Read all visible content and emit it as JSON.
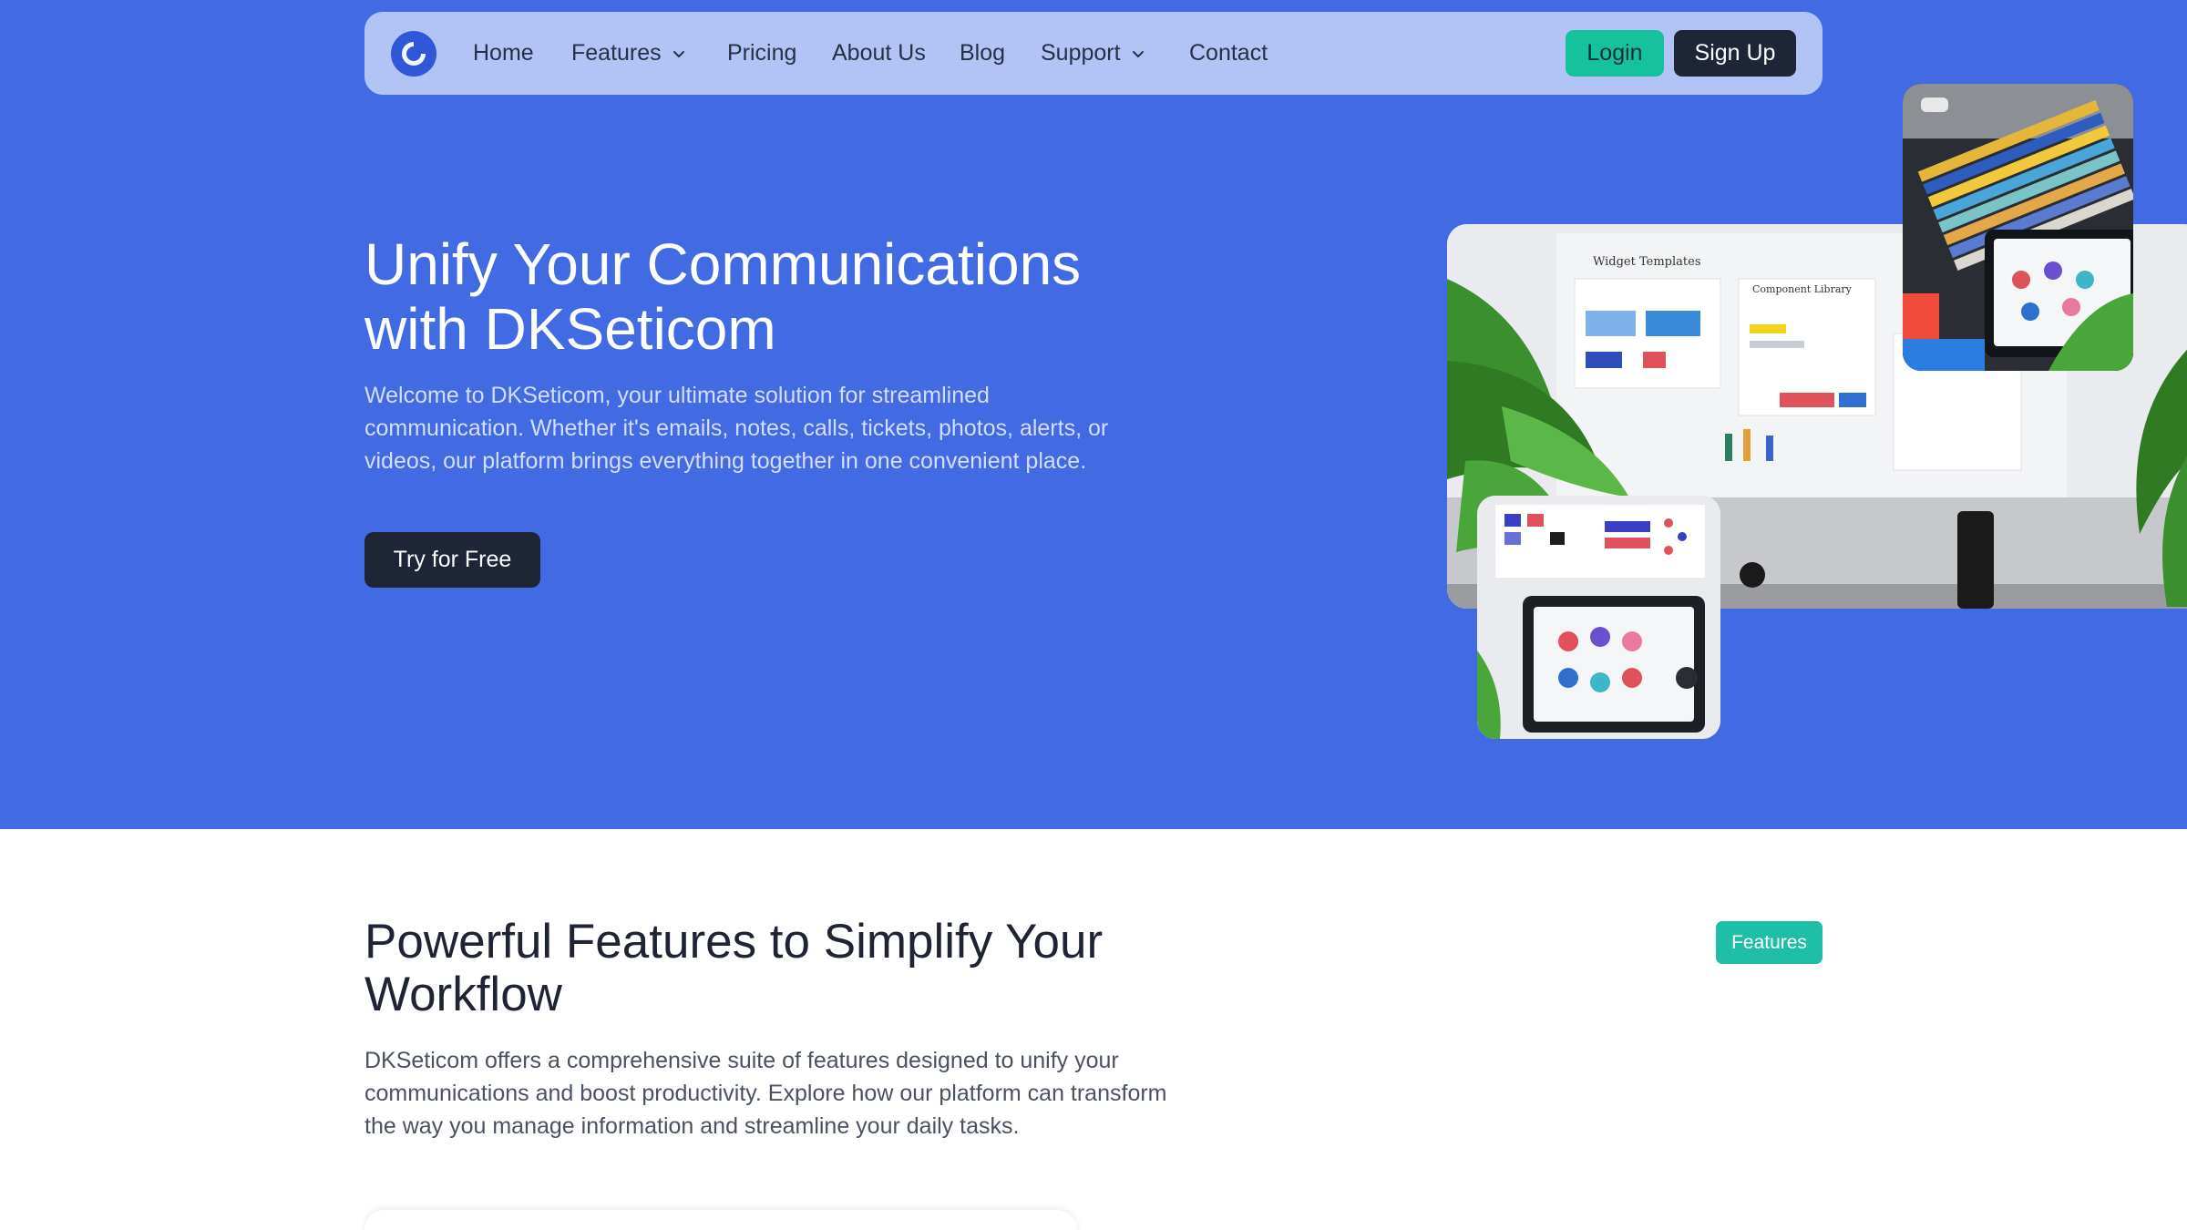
{
  "brand": {
    "logo_icon": "logo-icon",
    "primary_color": "#426ae2",
    "accent_color": "#15c29d",
    "dark_color": "#1e2537"
  },
  "nav": {
    "items": [
      {
        "label": "Home",
        "has_dropdown": false
      },
      {
        "label": "Features",
        "has_dropdown": true
      },
      {
        "label": "Pricing",
        "has_dropdown": false
      },
      {
        "label": "About Us",
        "has_dropdown": false
      },
      {
        "label": "Blog",
        "has_dropdown": false
      },
      {
        "label": "Support",
        "has_dropdown": true
      },
      {
        "label": "Contact",
        "has_dropdown": false
      }
    ],
    "login_label": "Login",
    "signup_label": "Sign Up"
  },
  "hero": {
    "title_line1": "Unify Your Communications",
    "title_line2": "with DKSeticom",
    "description": "Welcome to DKSeticom, your ultimate solution for streamlined communication. Whether it's emails, notes, calls, tickets, photos, alerts, or videos, our platform brings everything together in one convenient place.",
    "cta_label": "Try for Free",
    "images": {
      "main": {
        "caption_left": "Widget Templates",
        "caption_right": "Component Library"
      }
    }
  },
  "features": {
    "badge": "Features",
    "title": "Powerful Features to Simplify Your Workflow",
    "description": "DKSeticom offers a comprehensive suite of features designed to unify your communications and boost productivity. Explore how our platform can transform the way you manage information and streamline your daily tasks."
  }
}
